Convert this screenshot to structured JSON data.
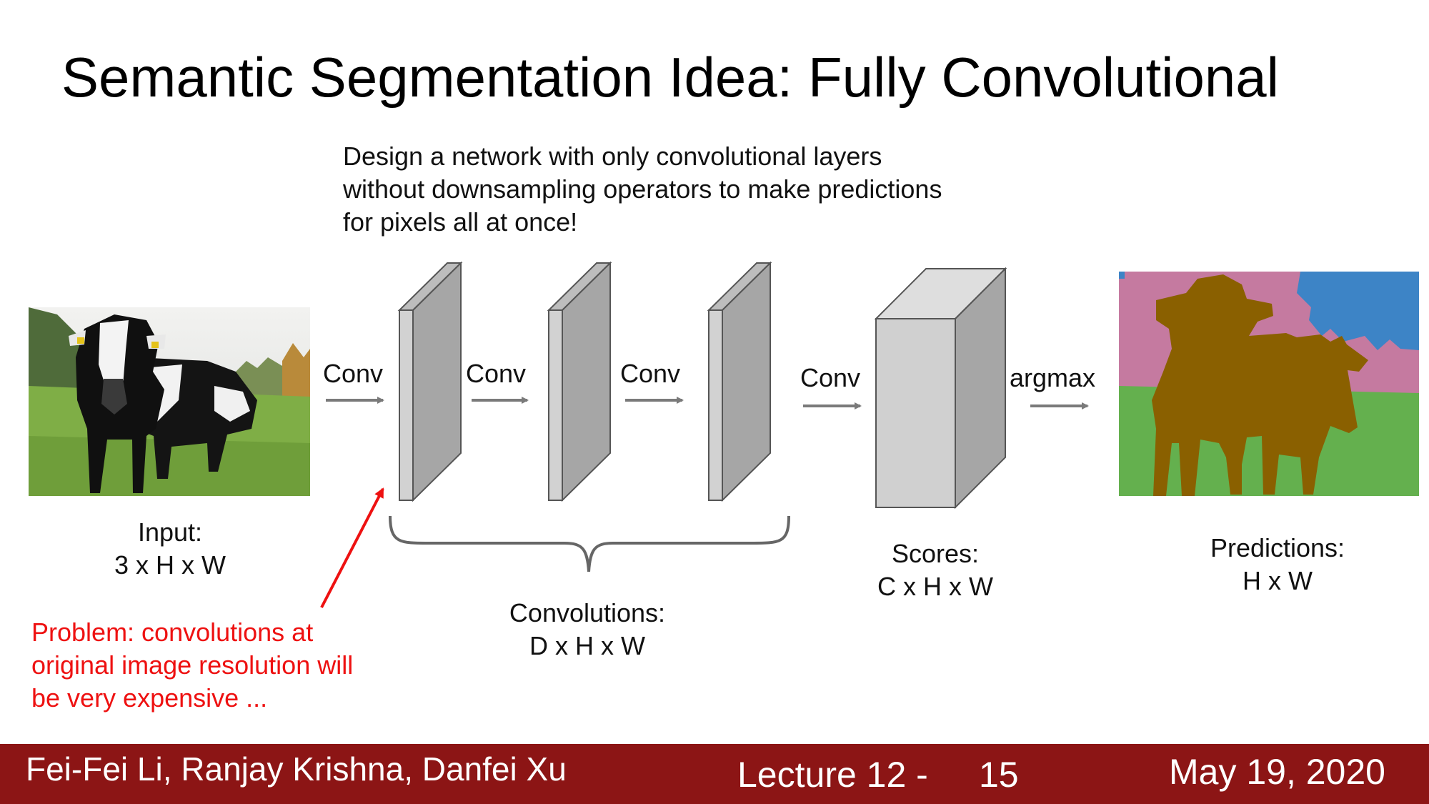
{
  "title": "Semantic Segmentation Idea: Fully Convolutional",
  "description": [
    "Design a network with only convolutional layers",
    "without downsampling operators to make predictions",
    "for pixels all at once!"
  ],
  "arrows": {
    "conv": "Conv",
    "argmax": "argmax"
  },
  "labels": {
    "input": [
      "Input:",
      "3 x H x W"
    ],
    "convolutions": [
      "Convolutions:",
      "D x H x W"
    ],
    "scores": [
      "Scores:",
      "C x H x W"
    ],
    "predictions": [
      "Predictions:",
      "H x W"
    ]
  },
  "problem": [
    "Problem: convolutions at",
    "original image resolution will",
    "be very expensive ..."
  ],
  "footer": {
    "authors": "Fei-Fei Li, Ranjay Krishna, Danfei Xu",
    "lecture": "Lecture 12 -",
    "page": "15",
    "date": "May 19, 2020"
  },
  "colors": {
    "footer_bg": "#8c1515",
    "problem_text": "#ee1111",
    "seg_background_pink": "#c57aa0",
    "seg_sky_blue": "#3d84c6",
    "seg_grass_green": "#64b04e",
    "seg_cow_brown": "#8a6000"
  }
}
